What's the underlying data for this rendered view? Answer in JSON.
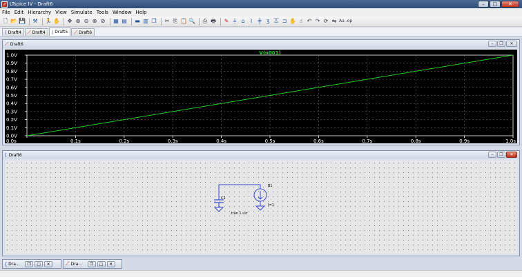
{
  "window": {
    "title": "LTspice IV - Draft6",
    "app_icon": "ltspice-logo-icon"
  },
  "menu": [
    "File",
    "Edit",
    "Hierarchy",
    "View",
    "Simulate",
    "Tools",
    "Window",
    "Help"
  ],
  "doc_tabs": [
    {
      "label": "Draft4",
      "icon": "schematic-icon"
    },
    {
      "label": "Draft4",
      "icon": "waveform-icon"
    },
    {
      "label": "Draft5",
      "icon": "schematic-icon"
    },
    {
      "label": "Draft6",
      "icon": "waveform-icon"
    }
  ],
  "wave_window": {
    "title": "Draft6"
  },
  "schematic_window": {
    "title": "Draft6"
  },
  "chart_data": {
    "type": "line",
    "title": "V(n001)",
    "x": [
      0,
      1.0
    ],
    "series": [
      {
        "name": "V(n001)",
        "values": [
          0,
          1.0
        ],
        "color": "#22cc22"
      }
    ],
    "x_ticks": [
      "0.0s",
      "0.1s",
      "0.2s",
      "0.3s",
      "0.4s",
      "0.5s",
      "0.6s",
      "0.7s",
      "0.8s",
      "0.9s",
      "1.0s"
    ],
    "y_ticks": [
      "0.0V",
      "0.1V",
      "0.2V",
      "0.3V",
      "0.4V",
      "0.5V",
      "0.6V",
      "0.7V",
      "0.8V",
      "0.9V",
      "1.0V"
    ],
    "xlim": [
      0,
      1.0
    ],
    "ylim": [
      0,
      1.0
    ],
    "grid": true,
    "background": "#000000",
    "axis_color": "#ffffff"
  },
  "schematic": {
    "c1_label": "C1",
    "b1_label": "B1",
    "b1_value": "I=1",
    "directive": ".tran 1 uic"
  },
  "minimized": [
    {
      "label": "Dra...",
      "icon": "schematic-icon"
    },
    {
      "label": "Dra...",
      "icon": "waveform-icon"
    }
  ]
}
